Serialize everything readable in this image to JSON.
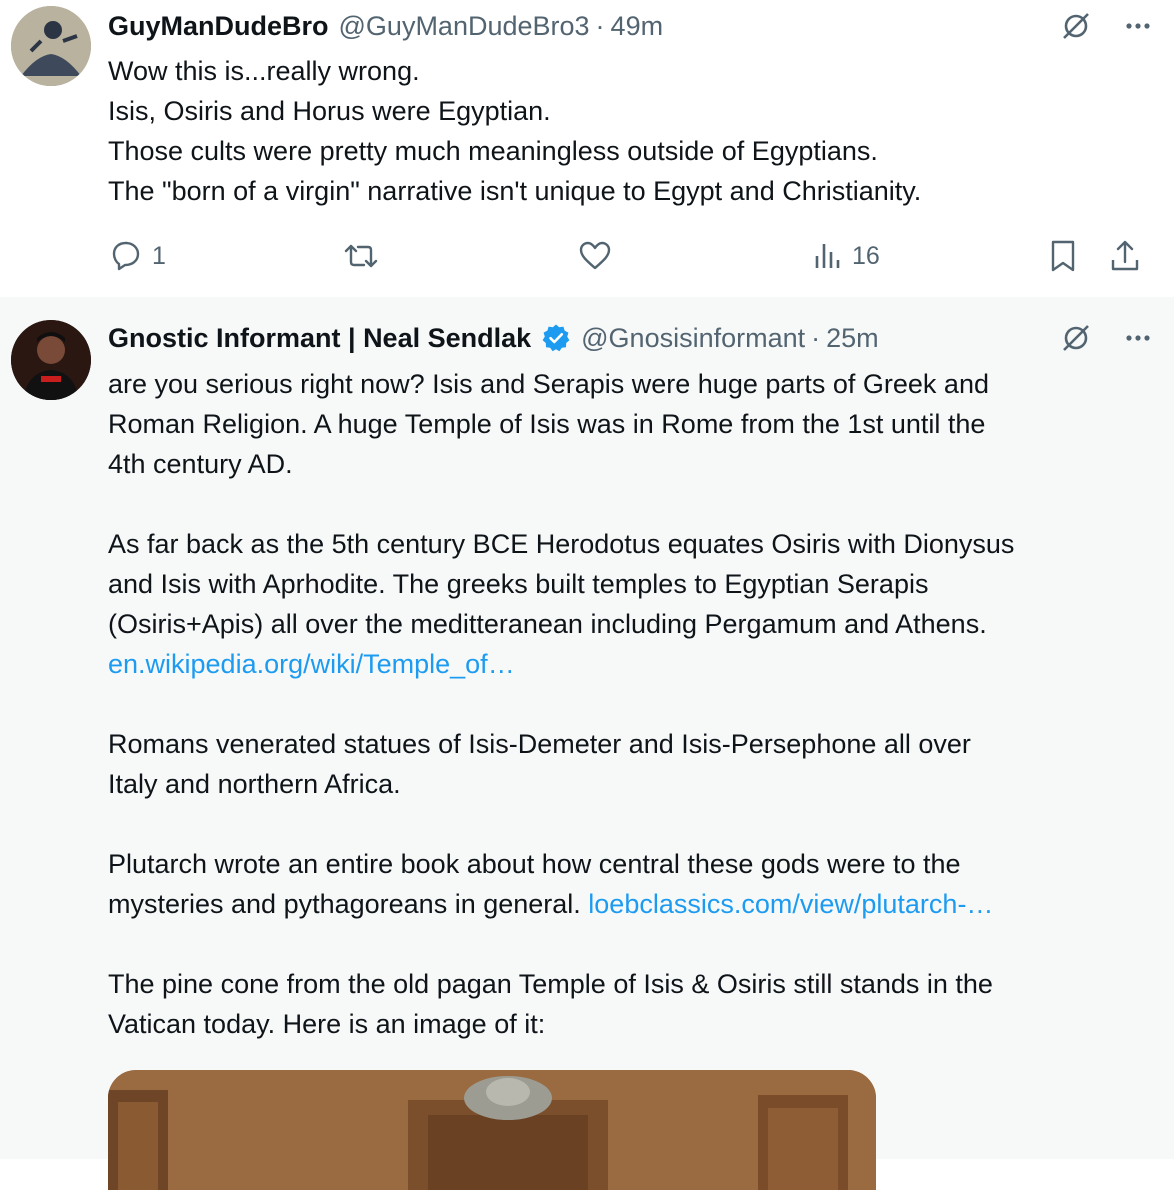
{
  "tweets": [
    {
      "name": "GuyManDudeBro",
      "handle": "@GuyManDudeBro3",
      "separator": "·",
      "time": "49m",
      "lines": [
        "Wow this is...really wrong.",
        "Isis, Osiris and Horus were Egyptian.",
        "Those cults were pretty much meaningless outside of Egyptians.",
        "The \"born of a virgin\" narrative isn't unique to Egypt and Christianity."
      ],
      "actions": {
        "reply_count": "1",
        "views_count": "16"
      }
    },
    {
      "name": "Gnostic Informant | Neal Sendlak",
      "handle": "@Gnosisinformant",
      "separator": "·",
      "time": "25m",
      "p1": [
        "are you serious right now? Isis and Serapis were huge parts of Greek and",
        "Roman Religion. A huge Temple of Isis was in Rome from the 1st until the",
        "4th century AD."
      ],
      "p2": [
        "As far back as the 5th century BCE Herodotus equates Osiris with Dionysus",
        "and Isis with Aprhodite. The greeks built temples to Egyptian Serapis",
        "(Osiris+Apis) all over the meditteranean including Pergamum and Athens."
      ],
      "p2_link": "en.wikipedia.org/wiki/Temple_of…",
      "p3": [
        "Romans venerated statues of Isis-Demeter and Isis-Persephone all over",
        "Italy and northern Africa."
      ],
      "p4_line1": "Plutarch wrote an entire book about how central these gods were to the",
      "p4_line2": "mysteries and pythagoreans in general.",
      "p4_link": "loebclassics.com/view/plutarch-…",
      "p5": [
        "The pine cone from the old pagan Temple of Isis & Osiris still stands in the",
        "Vatican today. Here is an image of it:"
      ]
    }
  ],
  "colors": {
    "text": "#0f1419",
    "secondary": "#536471",
    "link": "#1d9bf0",
    "verified": "#1d9bf0",
    "thread_line": "#cfd9de",
    "highlight_bg": "#f7f9f9"
  },
  "icons": [
    "grok-icon",
    "more-icon",
    "reply-icon",
    "retweet-icon",
    "like-icon",
    "views-icon",
    "bookmark-icon",
    "share-icon",
    "verified-badge-icon"
  ]
}
